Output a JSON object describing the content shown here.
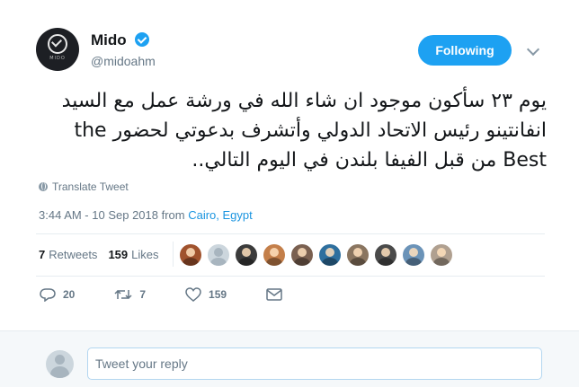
{
  "author": {
    "name": "Mido",
    "handle": "@midoahm",
    "avatar_text": "MIDO"
  },
  "header": {
    "follow_label": "Following"
  },
  "tweet": {
    "text": "يوم ٢٣ سأكون موجود ان شاء الله في ورشة عمل مع السيد انفانتينو رئيس الاتحاد الدولي وأتشرف بدعوتي لحضور the Best من قبل الفيفا بلندن في اليوم التالي..",
    "translate_label": "Translate Tweet",
    "time": "3:44 AM - 10 Sep 2018 from ",
    "location": "Cairo, Egypt"
  },
  "stats": {
    "retweets_count": "7",
    "retweets_label": "Retweets",
    "likes_count": "159",
    "likes_label": "Likes"
  },
  "actions": {
    "reply_count": "20",
    "retweet_count": "7",
    "like_count": "159"
  },
  "reply": {
    "placeholder": "Tweet your reply"
  },
  "colors": {
    "accent": "#1da1f2",
    "muted": "#657786",
    "text": "#14171a",
    "link": "#1b95e0"
  },
  "face_colors": [
    "#a0522d",
    "#ccd6dd",
    "#3b3b3b",
    "#c47f4a",
    "#7a6050",
    "#2e6f9e",
    "#8a7560",
    "#4a4a4a",
    "#6b93b8",
    "#b0a090"
  ]
}
